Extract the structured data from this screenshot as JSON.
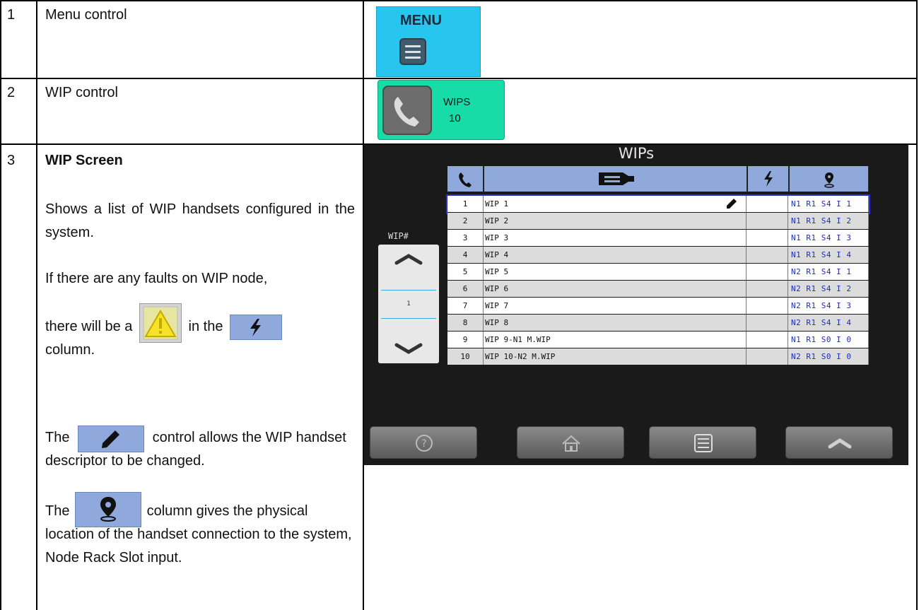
{
  "rows": [
    {
      "number": "1",
      "title": "Menu control"
    },
    {
      "number": "2",
      "title": "WIP control"
    },
    {
      "number": "3",
      "title": "WIP Screen",
      "desc_1": "Shows a list of WIP handsets configured in the system.",
      "desc_2a": "If there are any faults on WIP node,",
      "desc_2b": "there will be a",
      "desc_2c": "in the",
      "desc_2d": "column.",
      "desc_3a": "The",
      "desc_3b": "control allows the WIP handset descriptor to be changed.",
      "desc_4a": "The",
      "desc_4b": "column gives the physical location of the handset connection to the system, Node Rack Slot input."
    }
  ],
  "menu_button": {
    "label": "MENU",
    "icon": "hamburger-icon"
  },
  "wip_control": {
    "label": "WIPS",
    "value": "10",
    "icon": "phone-icon"
  },
  "wip_screen": {
    "title": "WIPs",
    "wip_number_label": "WIP#",
    "scroll_value": "1",
    "columns": [
      "phone-icon",
      "tag-icon",
      "lightning-icon",
      "location-pin-icon"
    ],
    "items": [
      {
        "num": "1",
        "name": "WIP 1",
        "loc": "N1 R1 S4 I 1"
      },
      {
        "num": "2",
        "name": "WIP 2",
        "loc": "N1 R1 S4 I 2"
      },
      {
        "num": "3",
        "name": "WIP 3",
        "loc": "N1 R1 S4 I 3"
      },
      {
        "num": "4",
        "name": "WIP 4",
        "loc": "N1 R1 S4 I 4"
      },
      {
        "num": "5",
        "name": "WIP 5",
        "loc": "N2 R1 S4 I 1"
      },
      {
        "num": "6",
        "name": "WIP 6",
        "loc": "N2 R1 S4 I 2"
      },
      {
        "num": "7",
        "name": "WIP 7",
        "loc": "N2 R1 S4 I 3"
      },
      {
        "num": "8",
        "name": "WIP 8",
        "loc": "N2 R1 S4 I 4"
      },
      {
        "num": "9",
        "name": "WIP 9-N1 M.WIP",
        "loc": "N1 R1 S0 I 0"
      },
      {
        "num": "10",
        "name": "WIP 10-N2 M.WIP",
        "loc": "N2 R1 S0 I 0"
      }
    ],
    "nav_buttons": [
      "help-icon",
      "home-icon",
      "menu-icon",
      "up-icon"
    ]
  }
}
